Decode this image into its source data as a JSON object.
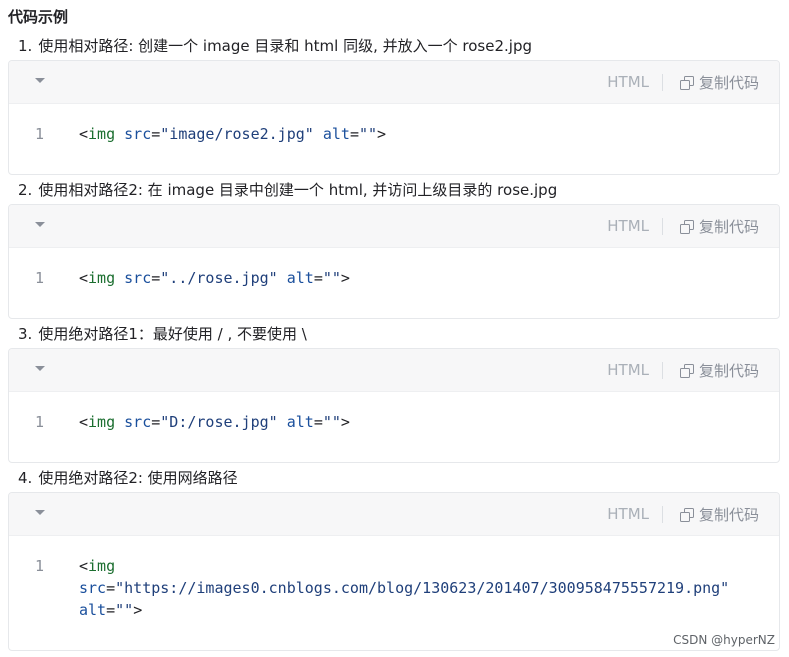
{
  "heading": "代码示例",
  "copy_label": "复制代码",
  "watermark": "CSDN @hyperNZ",
  "examples": [
    {
      "number": "1.",
      "description": "使用相对路径: 创建一个 image 目录和 html 同级, 并放入一个 rose2.jpg",
      "language": "HTML",
      "line_number": "1",
      "code": {
        "open": "<",
        "tag": "img",
        "attr1": "src",
        "eq1": "=",
        "val1": "\"image/rose2.jpg\"",
        "attr2": "alt",
        "eq2": "=",
        "val2": "\"\"",
        "close": ">"
      }
    },
    {
      "number": "2.",
      "description": "使用相对路径2: 在 image 目录中创建一个 html, 并访问上级目录的 rose.jpg",
      "language": "HTML",
      "line_number": "1",
      "code": {
        "open": "<",
        "tag": "img",
        "attr1": "src",
        "eq1": "=",
        "val1": "\"../rose.jpg\"",
        "attr2": "alt",
        "eq2": "=",
        "val2": "\"\"",
        "close": ">"
      }
    },
    {
      "number": "3.",
      "description": "使用绝对路径1：最好使用 / , 不要使用 \\",
      "language": "HTML",
      "line_number": "1",
      "code": {
        "open": "<",
        "tag": "img",
        "attr1": "src",
        "eq1": "=",
        "val1": "\"D:/rose.jpg\"",
        "attr2": "alt",
        "eq2": "=",
        "val2": "\"\"",
        "close": ">"
      }
    },
    {
      "number": "4.",
      "description": "使用绝对路径2: 使用网络路径",
      "language": "HTML",
      "line_number": "1",
      "code": {
        "open": "<",
        "tag": "img",
        "attr1": "src",
        "eq1": "=",
        "val1": "\"https://images0.cnblogs.com/blog/130623/201407/300958475557219.png\"",
        "attr2": "alt",
        "eq2": "=",
        "val2": "\"\"",
        "close": ">"
      }
    }
  ]
}
